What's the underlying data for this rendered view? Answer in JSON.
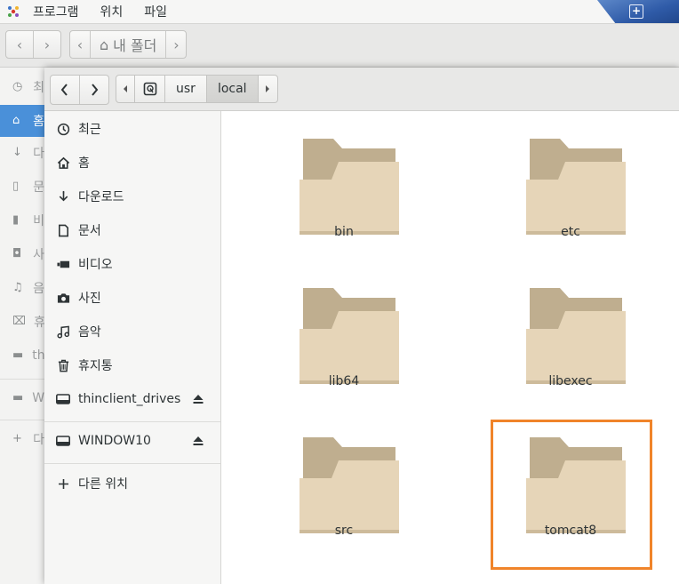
{
  "menubar": {
    "items": [
      "프로그램",
      "위치",
      "파일"
    ],
    "apps_icon": "gnome-apps-icon",
    "corner_icon": "plus-icon"
  },
  "background_window": {
    "path_label": "내 폴더",
    "sidebar_fragments": [
      "최",
      "홈",
      "다",
      "문",
      "비",
      "사",
      "음",
      "휴",
      "th",
      "W",
      "다"
    ]
  },
  "window": {
    "path": {
      "segments": [
        "usr",
        "local"
      ],
      "current": "local"
    },
    "sidebar": {
      "items": [
        {
          "label": "최근",
          "icon": "clock-icon"
        },
        {
          "label": "홈",
          "icon": "home-icon"
        },
        {
          "label": "다운로드",
          "icon": "download-icon"
        },
        {
          "label": "문서",
          "icon": "document-icon"
        },
        {
          "label": "비디오",
          "icon": "video-icon"
        },
        {
          "label": "사진",
          "icon": "camera-icon"
        },
        {
          "label": "음악",
          "icon": "music-icon"
        },
        {
          "label": "휴지통",
          "icon": "trash-icon"
        }
      ],
      "drives": [
        {
          "label": "thinclient_drives",
          "icon": "drive-icon",
          "eject": "eject-icon"
        },
        {
          "label": "WINDOW10",
          "icon": "drive-icon",
          "eject": "eject-icon"
        }
      ],
      "other_locations": "다른 위치"
    },
    "folders": [
      "bin",
      "etc",
      "lib64",
      "libexec",
      "src",
      "tomcat8"
    ],
    "highlighted_folder": "tomcat8"
  },
  "colors": {
    "accent": "#4a90d9",
    "highlight": "#f0842a",
    "folder_back": "#bfae8f",
    "folder_front": "#e6d5b8"
  }
}
